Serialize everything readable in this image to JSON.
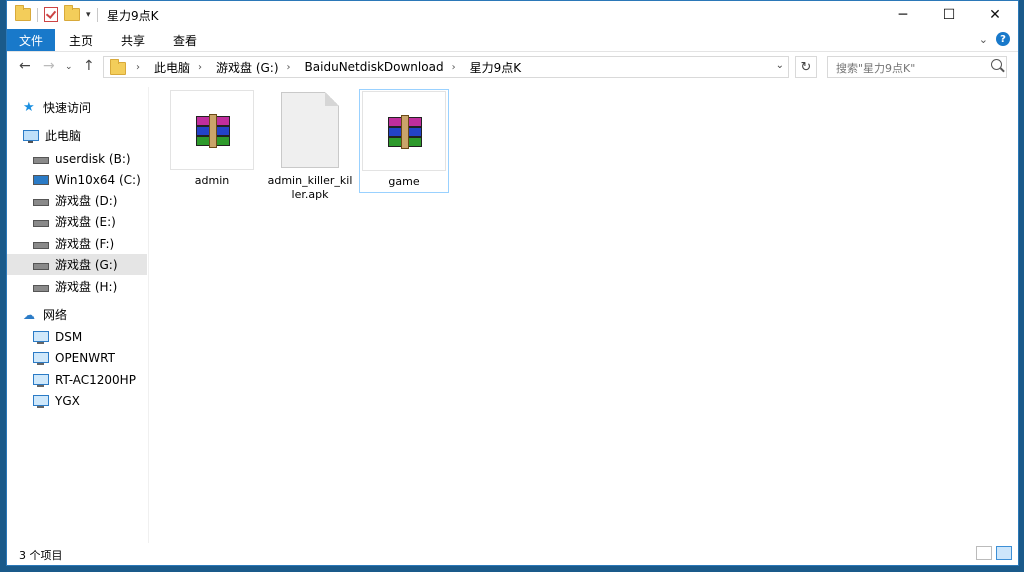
{
  "window": {
    "title": "星力9点K"
  },
  "ribbon": {
    "file_tab": "文件",
    "tabs": [
      "主页",
      "共享",
      "查看"
    ]
  },
  "address": {
    "crumbs": [
      "此电脑",
      "游戏盘 (G:)",
      "BaiduNetdiskDownload",
      "星力9点K"
    ]
  },
  "search": {
    "placeholder": "搜索\"星力9点K\""
  },
  "sidebar": {
    "quick_access": "快速访问",
    "this_pc": "此电脑",
    "drives": [
      "userdisk (B:)",
      "Win10x64 (C:)",
      "游戏盘 (D:)",
      "游戏盘 (E:)",
      "游戏盘 (F:)",
      "游戏盘 (G:)",
      "游戏盘 (H:)"
    ],
    "network": "网络",
    "network_items": [
      "DSM",
      "OPENWRT",
      "RT-AC1200HP",
      "YGX"
    ]
  },
  "files": [
    {
      "name": "admin",
      "icon": "winrar-archive-icon"
    },
    {
      "name": "admin_killer_killer.apk",
      "icon": "blank-file-icon"
    },
    {
      "name": "game",
      "icon": "winrar-archive-icon"
    }
  ],
  "status": {
    "item_count": "3 个项目"
  }
}
